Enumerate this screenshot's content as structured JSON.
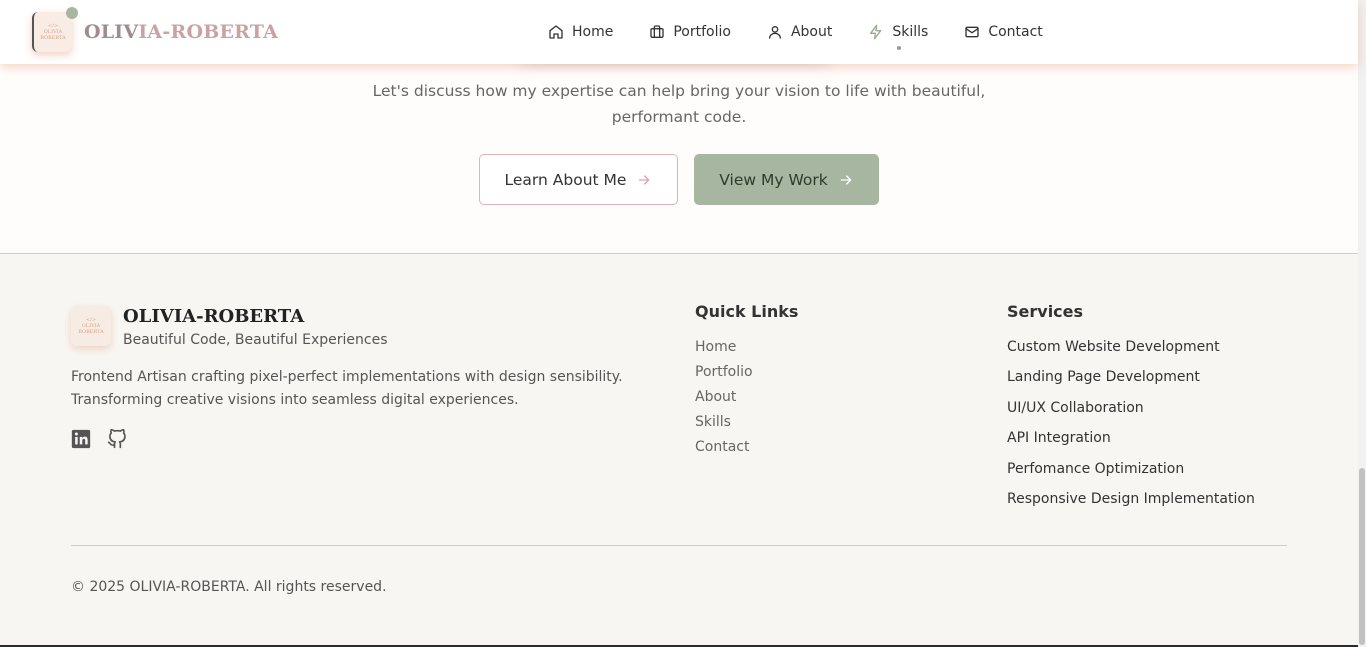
{
  "header": {
    "brand_name_a": "OLIV",
    "brand_name_b": "IA-ROBERTA",
    "badge_lines": [
      "</>",
      "OLIVIA",
      "ROBERTA"
    ],
    "nav": [
      {
        "label": "Home",
        "icon": "home-icon"
      },
      {
        "label": "Portfolio",
        "icon": "briefcase-icon"
      },
      {
        "label": "About",
        "icon": "user-icon"
      },
      {
        "label": "Skills",
        "icon": "lightning-icon",
        "active": true
      },
      {
        "label": "Contact",
        "icon": "mail-icon"
      }
    ]
  },
  "cta": {
    "text": "Let's discuss how my expertise can help bring your vision to life with beautiful, performant code.",
    "learn_label": "Learn About Me",
    "work_label": "View My Work"
  },
  "footer": {
    "brand_name": "OLIVIA-ROBERTA",
    "tagline": "Beautiful Code, Beautiful Experiences",
    "description_line1": "Frontend Artisan crafting pixel-perfect implementations with design sensibility.",
    "description_line2": "Transforming creative visions into seamless digital experiences.",
    "quick_links_title": "Quick Links",
    "quick_links": [
      "Home",
      "Portfolio",
      "About",
      "Skills",
      "Contact"
    ],
    "services_title": "Services",
    "services": [
      "Custom Website Development",
      "Landing Page Development",
      "UI/UX Collaboration",
      "API Integration",
      "Perfomance Optimization",
      "Responsive Design Implementation"
    ],
    "copyright": "© 2025 OLIVIA-ROBERTA. All rights reserved."
  },
  "colors": {
    "accent_sage": "#a7b6a0",
    "accent_rose": "#e0b4b8",
    "footer_bg": "#f8f6f3"
  }
}
